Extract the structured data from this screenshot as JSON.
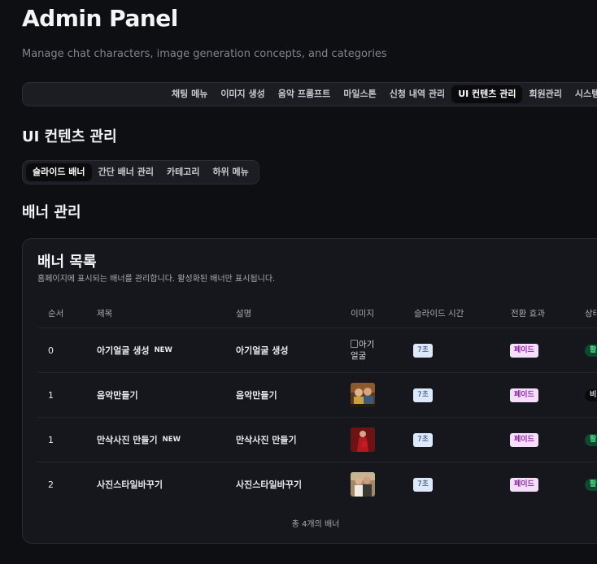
{
  "header": {
    "title": "Admin Panel",
    "subtitle": "Manage chat characters, image generation concepts, and categories"
  },
  "topnav": {
    "items": [
      "채팅 메뉴",
      "이미지 생성",
      "음악 프롬프트",
      "마일스톤",
      "신청 내역 관리",
      "UI 컨텐츠 관리",
      "회원관리",
      "시스템 설"
    ],
    "active_index": 5
  },
  "section_title": "UI 컨텐츠 관리",
  "subtabs": {
    "items": [
      "슬라이드 배너",
      "간단 배너 관리",
      "카테고리",
      "하위 메뉴"
    ],
    "active_index": 0
  },
  "banner_section_title": "배너 관리",
  "card": {
    "title": "배너 목록",
    "description": "홈페이지에 표시되는 배너를 관리합니다. 활성화된 배너만 표시됩니다.",
    "columns": [
      "순서",
      "제목",
      "설명",
      "이미지",
      "슬라이드 시간",
      "전환 효과",
      "상태"
    ],
    "rows": [
      {
        "order": "0",
        "title": "아기얼굴 생성",
        "is_new": true,
        "new_label": "NEW",
        "description": "아기얼굴 생성",
        "image_alt": "아기얼굴",
        "image_broken": true,
        "slide_time": "7초",
        "effect": "페이드",
        "status": "활",
        "status_active": true
      },
      {
        "order": "1",
        "title": "음악만들기",
        "is_new": false,
        "new_label": "",
        "description": "음악만들기",
        "image_alt": "",
        "image_broken": false,
        "slide_time": "7초",
        "effect": "페이드",
        "status": "비",
        "status_active": false
      },
      {
        "order": "1",
        "title": "만삭사진 만들기",
        "is_new": true,
        "new_label": "NEW",
        "description": "만삭사진 만들기",
        "image_alt": "",
        "image_broken": false,
        "slide_time": "7초",
        "effect": "페이드",
        "status": "활",
        "status_active": true
      },
      {
        "order": "2",
        "title": "사진스타일바꾸기",
        "is_new": false,
        "new_label": "",
        "description": "사진스타일바꾸기",
        "image_alt": "",
        "image_broken": false,
        "slide_time": "7초",
        "effect": "페이드",
        "status": "활",
        "status_active": true
      }
    ],
    "footer": "총 4개의 배너"
  },
  "colors": {
    "background": "#0e0f13",
    "card": "#16171c",
    "status_active_bg": "#0d4a2c",
    "status_active_fg": "#57d88f",
    "time_badge_bg": "#dde8fb",
    "effect_badge_bg": "#f4def9",
    "effect_badge_fg": "#8d2aa6"
  }
}
